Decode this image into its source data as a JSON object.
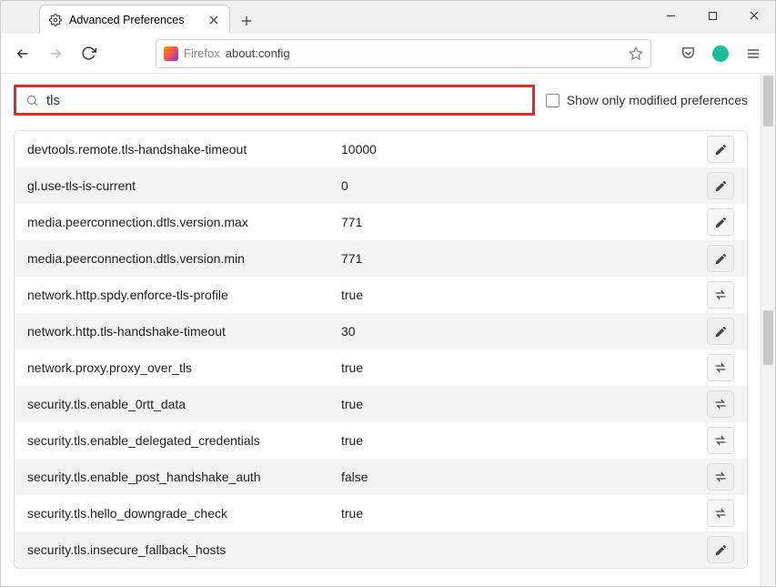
{
  "window": {
    "tab_title": "Advanced Preferences"
  },
  "addressbar": {
    "label": "Firefox",
    "url": "about:config"
  },
  "search": {
    "value": "tls",
    "show_only_label": "Show only modified preferences"
  },
  "prefs": [
    {
      "name": "devtools.remote.tls-handshake-timeout",
      "value": "10000",
      "action": "edit"
    },
    {
      "name": "gl.use-tls-is-current",
      "value": "0",
      "action": "edit"
    },
    {
      "name": "media.peerconnection.dtls.version.max",
      "value": "771",
      "action": "edit"
    },
    {
      "name": "media.peerconnection.dtls.version.min",
      "value": "771",
      "action": "edit"
    },
    {
      "name": "network.http.spdy.enforce-tls-profile",
      "value": "true",
      "action": "toggle"
    },
    {
      "name": "network.http.tls-handshake-timeout",
      "value": "30",
      "action": "edit"
    },
    {
      "name": "network.proxy.proxy_over_tls",
      "value": "true",
      "action": "toggle"
    },
    {
      "name": "security.tls.enable_0rtt_data",
      "value": "true",
      "action": "toggle"
    },
    {
      "name": "security.tls.enable_delegated_credentials",
      "value": "true",
      "action": "toggle"
    },
    {
      "name": "security.tls.enable_post_handshake_auth",
      "value": "false",
      "action": "toggle"
    },
    {
      "name": "security.tls.hello_downgrade_check",
      "value": "true",
      "action": "toggle"
    },
    {
      "name": "security.tls.insecure_fallback_hosts",
      "value": "",
      "action": "edit"
    }
  ]
}
